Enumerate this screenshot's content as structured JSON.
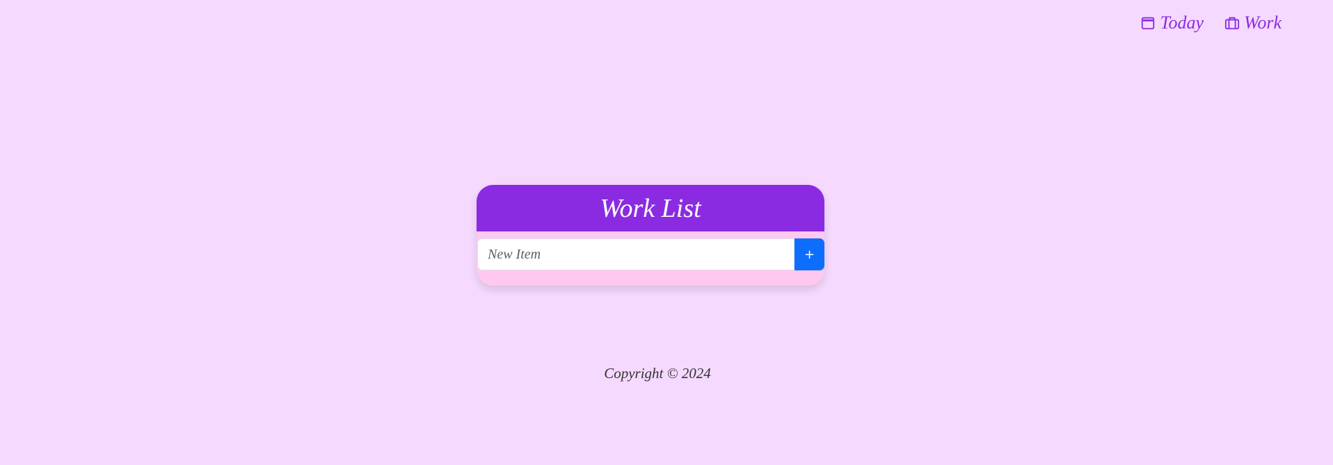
{
  "nav": {
    "items": [
      {
        "label": "Today",
        "icon": "calendar-icon"
      },
      {
        "label": "Work",
        "icon": "briefcase-icon"
      }
    ]
  },
  "card": {
    "title": "Work List",
    "input_placeholder": "New Item",
    "add_label": "+"
  },
  "footer": {
    "text": "Copyright © 2024"
  },
  "colors": {
    "background": "#f5d9fe",
    "accent": "#8a2be2",
    "card": "#ffc8f0",
    "button": "#0d6efd"
  }
}
